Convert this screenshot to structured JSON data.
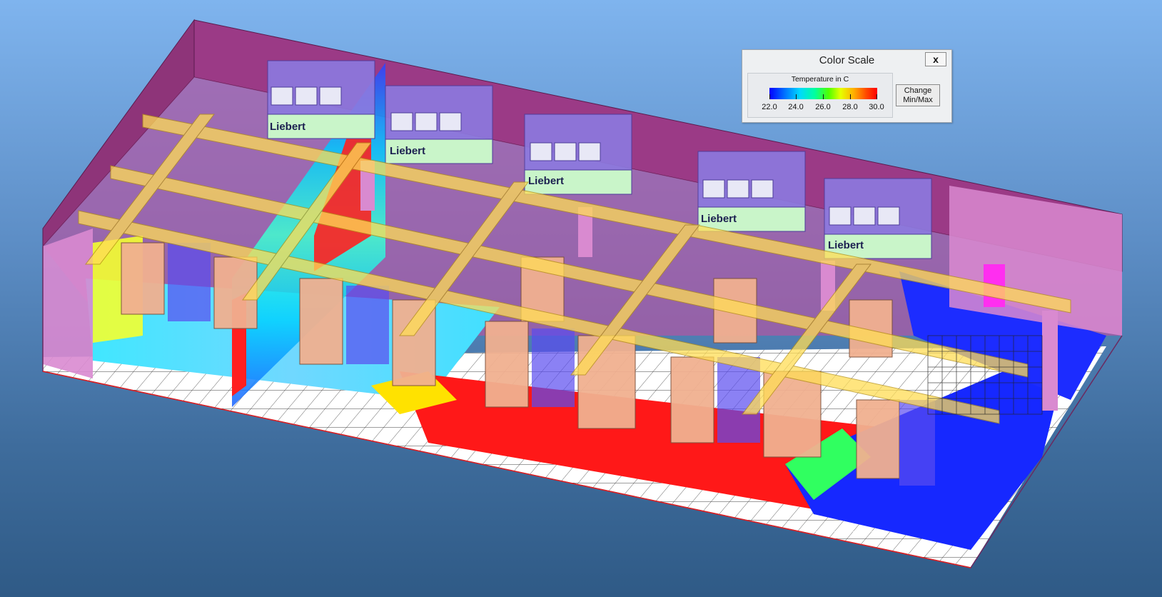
{
  "scene": {
    "unit_label": "Liebert",
    "unit_count": 5
  },
  "color_scale": {
    "title": "Color Scale",
    "close_label": "x",
    "legend_title": "Temperature in C",
    "ticks": [
      "22.0",
      "24.0",
      "26.0",
      "28.0",
      "30.0"
    ],
    "range": [
      22.0,
      30.0
    ],
    "change_button_line1": "Change",
    "change_button_line2": "Min/Max",
    "gradient_colors": [
      "#0000ff",
      "#00d8ff",
      "#50ff00",
      "#e6ff00",
      "#ff0000"
    ]
  }
}
